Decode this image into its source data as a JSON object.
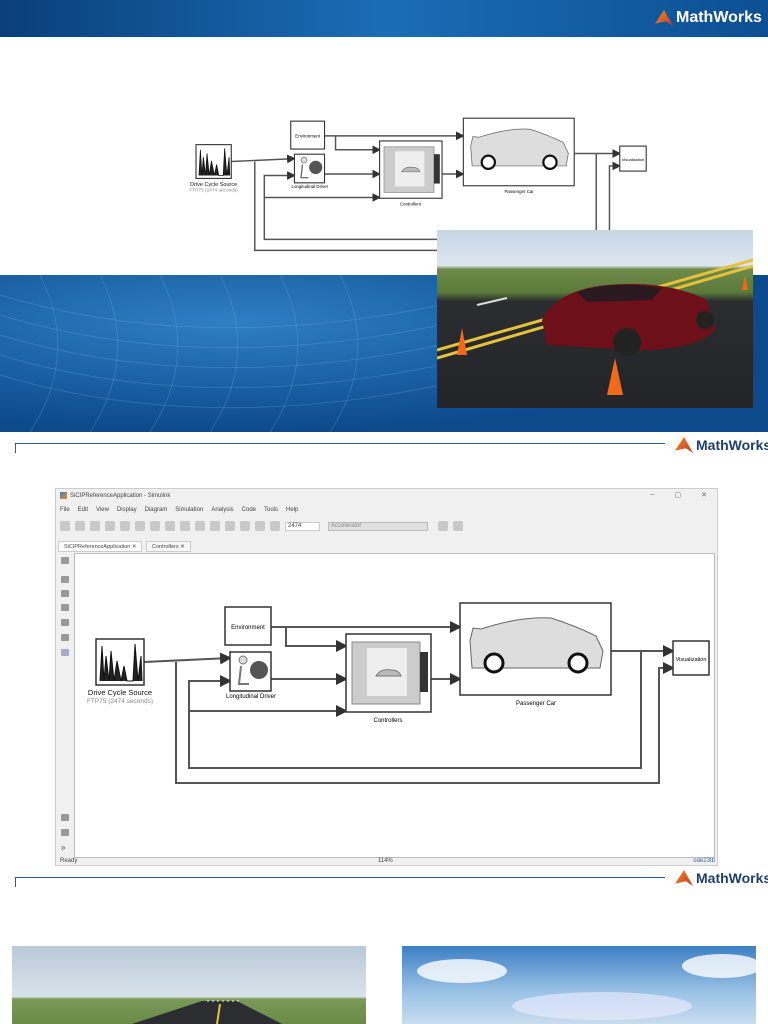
{
  "brand": {
    "logo_text": "MathWorks"
  },
  "diagram": {
    "drive_cycle_source": "Drive Cycle Source",
    "drive_cycle_sub": "FTP75 (2474  seconds)",
    "environment": "Environment",
    "longitudinal_driver": "Longitudinal Driver",
    "controllers": "Controllers",
    "passenger_car": "Passenger Car",
    "visualization": "Visualization"
  },
  "simulink": {
    "title": "SiCIPReferenceApplication - Simulink",
    "menu": [
      "File",
      "Edit",
      "View",
      "Display",
      "Diagram",
      "Simulation",
      "Analysis",
      "Code",
      "Tools",
      "Help"
    ],
    "stop_time": "2474",
    "sim_mode": "Accelerator",
    "tabs": [
      "SiCIPReferenceApplication",
      "Controllers"
    ],
    "status": {
      "left": "Ready",
      "zoom": "114%",
      "solver": "ode23tb"
    },
    "window_controls": {
      "minimize": "–",
      "maximize": "▢",
      "close": "✕"
    }
  },
  "colors": {
    "brand_blue": "#0c4a8c",
    "accent_orange": "#f08a24"
  }
}
